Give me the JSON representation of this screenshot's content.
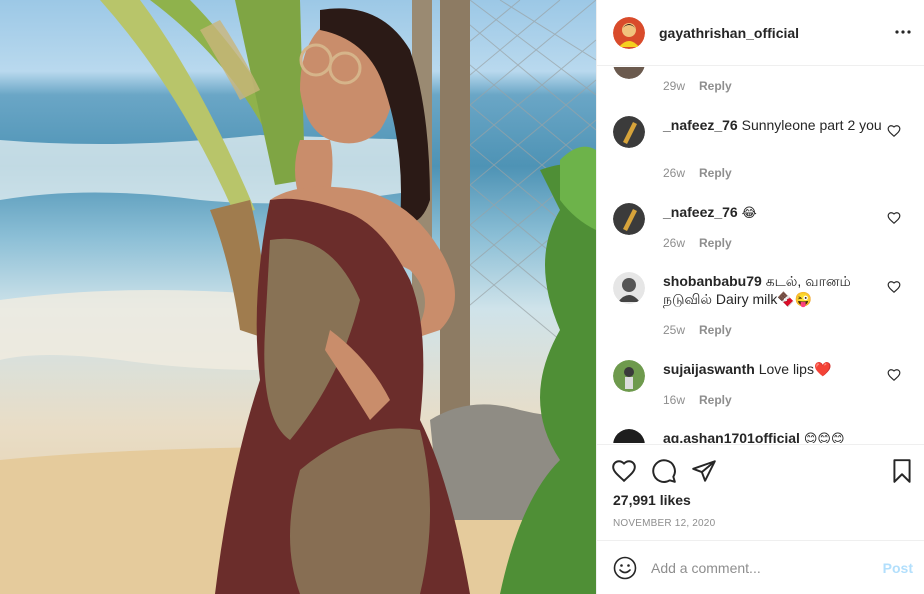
{
  "post": {
    "username": "gayathrishan_official",
    "likes": "27,991 likes",
    "date": "NOVEMBER 12, 2020"
  },
  "comments": [
    {
      "username": "",
      "text": "",
      "time": "29w",
      "reply": "Reply"
    },
    {
      "username": "_nafeez_76",
      "text": "Sunnyleone part 2 you",
      "time": "26w",
      "reply": "Reply"
    },
    {
      "username": "_nafeez_76",
      "text": "😂",
      "time": "26w",
      "reply": "Reply"
    },
    {
      "username": "shobanbabu79",
      "text": "கடல், வானம் நடுவில் Dairy milk🍫😜",
      "time": "25w",
      "reply": "Reply"
    },
    {
      "username": "sujaijaswanth",
      "text": "Love lips❤️",
      "time": "16w",
      "reply": "Reply"
    },
    {
      "username": "ag.ashan1701official",
      "text": "😊😊😊",
      "time": "",
      "reply": ""
    }
  ],
  "add_comment": {
    "placeholder": "Add a comment...",
    "post_label": "Post"
  },
  "colors": {
    "text": "#262626",
    "secondary": "#8e8e8e",
    "border": "#efefef",
    "post_disabled": "#b2dffc"
  },
  "icons": [
    "more-options-icon",
    "heart-icon",
    "comment-icon",
    "share-icon",
    "bookmark-icon",
    "emoji-icon"
  ]
}
